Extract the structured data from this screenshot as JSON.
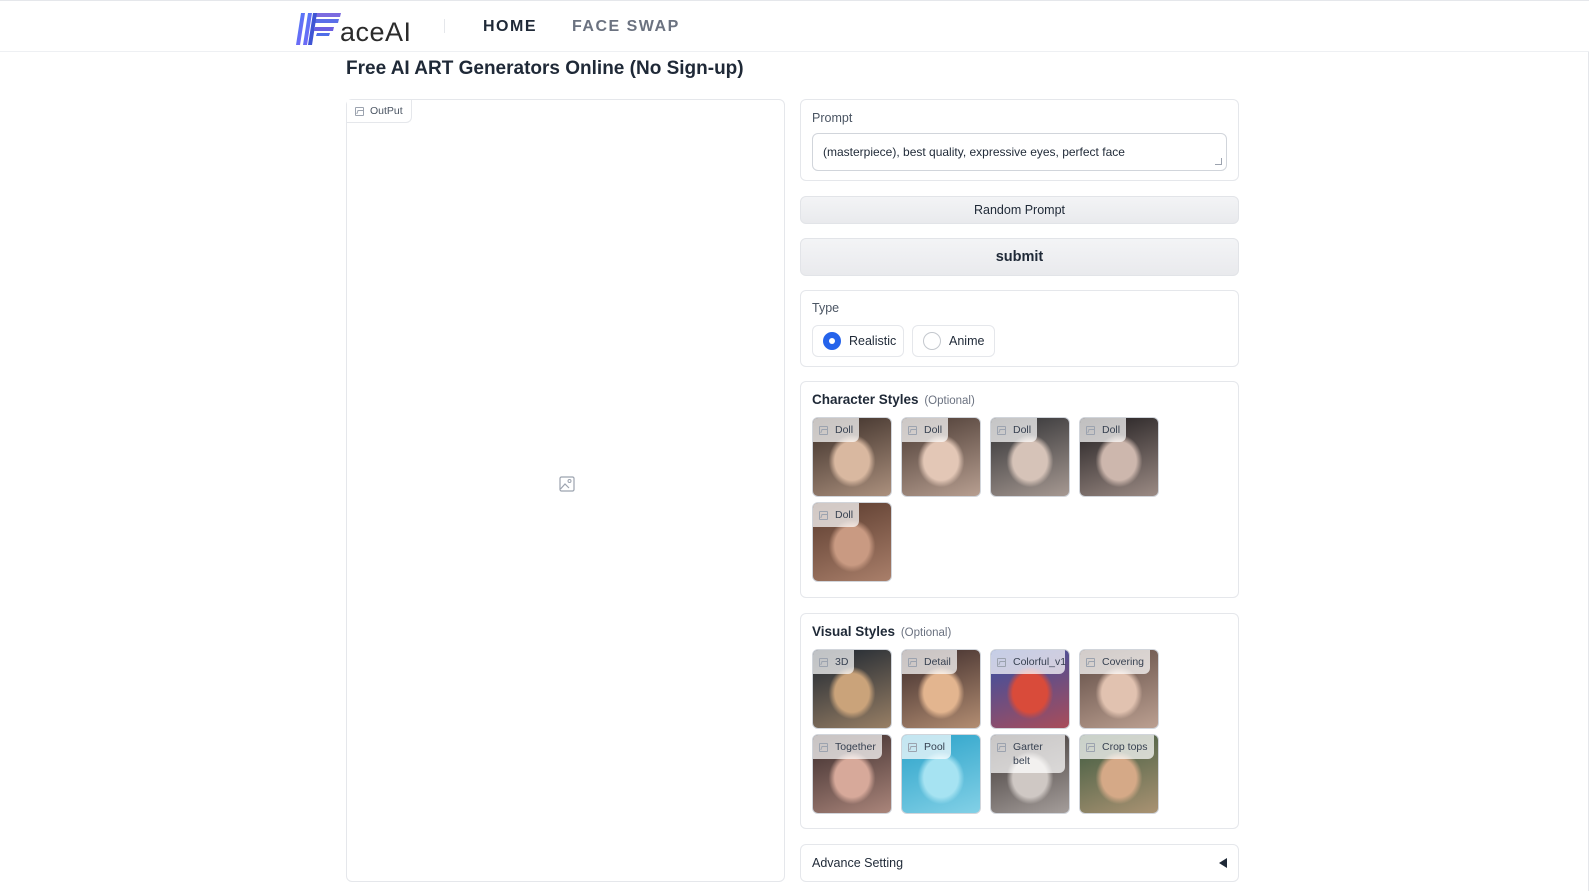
{
  "brand": {
    "name": "aceAI"
  },
  "nav": {
    "home": "HOME",
    "face_swap": "FACE SWAP"
  },
  "page_title": "Free AI ART Generators Online (No Sign-up)",
  "output": {
    "label": "OutPut"
  },
  "prompt": {
    "label": "Prompt",
    "value": "(masterpiece), best quality, expressive eyes, perfect face"
  },
  "buttons": {
    "random_prompt": "Random Prompt",
    "submit": "submit"
  },
  "type": {
    "label": "Type",
    "options": [
      "Realistic",
      "Anime"
    ],
    "selected": "Realistic"
  },
  "character_styles": {
    "title": "Character Styles",
    "optional": "(Optional)",
    "items": [
      {
        "label": "Doll",
        "colors": [
          "#3a2d27",
          "#d9b8a0"
        ]
      },
      {
        "label": "Doll",
        "colors": [
          "#4a3a33",
          "#e3c7b6"
        ]
      },
      {
        "label": "Doll",
        "colors": [
          "#2f3033",
          "#d6c3b8"
        ]
      },
      {
        "label": "Doll",
        "colors": [
          "#1f1c1e",
          "#cdb7ad"
        ]
      },
      {
        "label": "Doll",
        "colors": [
          "#5a3b2e",
          "#c99a82"
        ]
      }
    ]
  },
  "visual_styles": {
    "title": "Visual Styles",
    "optional": "(Optional)",
    "items": [
      {
        "label": "3D",
        "colors": [
          "#1b2530",
          "#caa37a"
        ]
      },
      {
        "label": "Detail",
        "colors": [
          "#3b2a2a",
          "#e3b58f"
        ]
      },
      {
        "label": "Colorful_v1",
        "colors": [
          "#3150a8",
          "#d94b3a"
        ]
      },
      {
        "label": "Covering",
        "colors": [
          "#5e4a43",
          "#e1c2b0"
        ]
      },
      {
        "label": "Together",
        "colors": [
          "#3a2b2b",
          "#d7a99a"
        ]
      },
      {
        "label": "Pool",
        "colors": [
          "#2aa2c9",
          "#a6e3f2"
        ]
      },
      {
        "label": "Garter belt",
        "colors": [
          "#3b3433",
          "#cfc8c4"
        ]
      },
      {
        "label": "Crop tops",
        "colors": [
          "#3d5a3f",
          "#d5a987"
        ]
      }
    ]
  },
  "advance_setting": {
    "label": "Advance Setting"
  },
  "colors": {
    "accent": "#2563eb",
    "logo_blue": "#3b4fd6",
    "logo_purple": "#8b5cf6"
  }
}
